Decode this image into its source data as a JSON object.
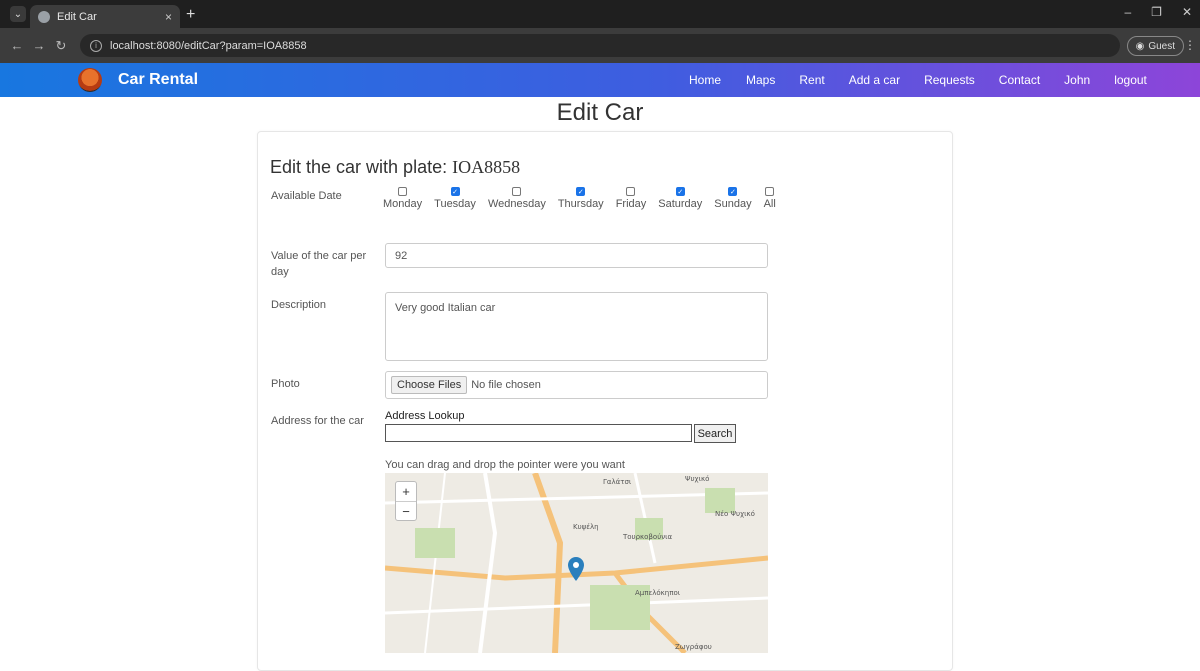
{
  "browser": {
    "tab_title": "Edit Car",
    "tab_close": "×",
    "new_tab": "+",
    "url": "localhost:8080/editCar?param=IOA8858",
    "guest_label": "Guest",
    "window_controls": [
      "–",
      "❐",
      "✕"
    ]
  },
  "navbar": {
    "brand": "Car Rental",
    "items": [
      "Home",
      "Maps",
      "Rent",
      "Add a car",
      "Requests",
      "Contact",
      "John",
      "logout"
    ]
  },
  "page": {
    "title": "Edit Car",
    "card_title_prefix": "Edit the car with plate: ",
    "plate": "IOA8858"
  },
  "form": {
    "available_date_label": "Available Date",
    "days": [
      {
        "label": "Monday",
        "checked": false
      },
      {
        "label": "Tuesday",
        "checked": true
      },
      {
        "label": "Wednesday",
        "checked": false
      },
      {
        "label": "Thursday",
        "checked": true
      },
      {
        "label": "Friday",
        "checked": false
      },
      {
        "label": "Saturday",
        "checked": true
      },
      {
        "label": "Sunday",
        "checked": true
      },
      {
        "label": "All",
        "checked": false
      }
    ],
    "value_label": "Value of the car per day",
    "value": "92",
    "description_label": "Description",
    "description": "Very good Italian car",
    "photo_label": "Photo",
    "choose_files": "Choose Files",
    "no_file": "No file chosen",
    "address_label": "Address for the car",
    "address_lookup_label": "Address Lookup",
    "address_lookup_value": "",
    "search_button": "Search",
    "drag_hint": "You can drag and drop the pointer were you want"
  },
  "map": {
    "zoom_in": "+",
    "zoom_out": "−",
    "place_labels": [
      "Γαλάτσι",
      "Ψυχικό",
      "Νέο Ψυχικό",
      "Κυψέλη",
      "Τουρκοβούνια",
      "Αμπελόκηποι",
      "Ζωγράφου"
    ],
    "marker_icon": "map-pin",
    "colors": {
      "park": "#c9dfb0",
      "major_road": "#f5c27a",
      "road": "#ffffff"
    }
  },
  "colors": {
    "nav_gradient_start": "#1877e0",
    "nav_gradient_end": "#8d45d9",
    "checkbox_checked": "#1a73e8",
    "marker": "#2a7fbd"
  }
}
